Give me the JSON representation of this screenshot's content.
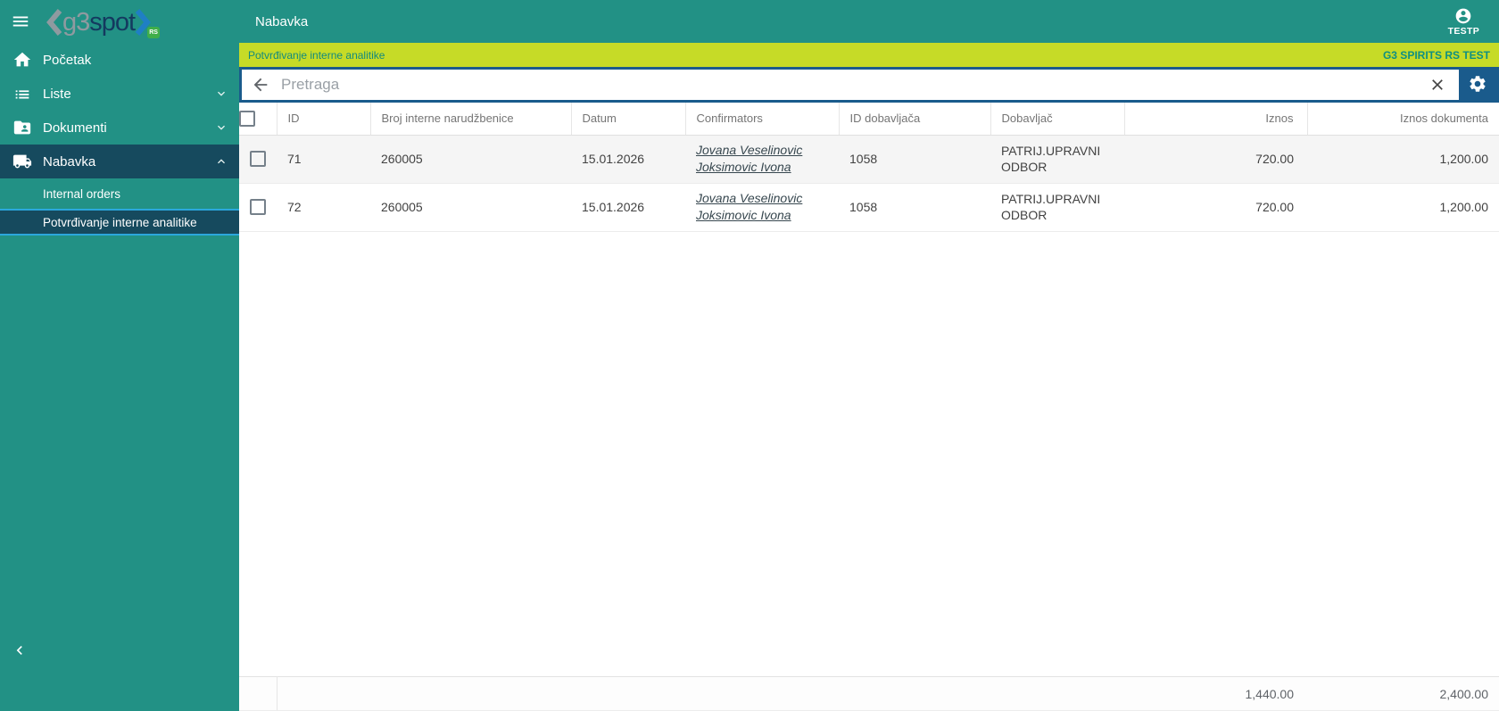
{
  "sidebar": {
    "logo": {
      "gray_text": "g3",
      "dark_text": "spot",
      "badge": "RS"
    },
    "items": [
      {
        "label": "Početak",
        "icon": "home"
      },
      {
        "label": "Liste",
        "icon": "list",
        "chevron": "down"
      },
      {
        "label": "Dokumenti",
        "icon": "folder-shared",
        "chevron": "down"
      },
      {
        "label": "Nabavka",
        "icon": "truck",
        "chevron": "up",
        "active": true
      }
    ],
    "subitems": [
      {
        "label": "Internal orders",
        "selected": false
      },
      {
        "label": "Potvrđivanje interne analitike",
        "selected": true
      }
    ]
  },
  "topbar": {
    "title": "Nabavka",
    "user": "TESTP"
  },
  "crumb_bar": {
    "label": "Potvrđivanje interne analitike",
    "company": "G3 SPIRITS RS TEST"
  },
  "search": {
    "placeholder": "Pretraga"
  },
  "table": {
    "columns": [
      "ID",
      "Broj interne narudžbenice",
      "Datum",
      "Confirmators",
      "ID dobavljača",
      "Dobavljač",
      "Iznos",
      "Iznos dokumenta"
    ],
    "rows": [
      {
        "id": "71",
        "order_number": "260005",
        "date": "15.01.2026",
        "confirmators": [
          "Jovana Veselinovic",
          "Joksimovic Ivona"
        ],
        "supplier_id": "1058",
        "supplier": "PATRIJ.UPRAVNI ODBOR",
        "amount": "720.00",
        "document_amount": "1,200.00"
      },
      {
        "id": "72",
        "order_number": "260005",
        "date": "15.01.2026",
        "confirmators": [
          "Jovana Veselinovic",
          "Joksimovic Ivona"
        ],
        "supplier_id": "1058",
        "supplier": "PATRIJ.UPRAVNI ODBOR",
        "amount": "720.00",
        "document_amount": "1,200.00"
      }
    ],
    "totals": {
      "amount": "1,440.00",
      "document_amount": "2,400.00"
    }
  },
  "colors": {
    "sidebar_teal": "#229185",
    "active_item_dark": "#164a5e",
    "selected_border_blue": "#2ba7dc",
    "crumb_yellow": "#c6db27",
    "crumb_text_teal": "#128a7e",
    "search_border_blue": "#1a5b8c",
    "logo_badge_green": "#3fae49",
    "row_stripe_gray": "#f5f5f5"
  }
}
